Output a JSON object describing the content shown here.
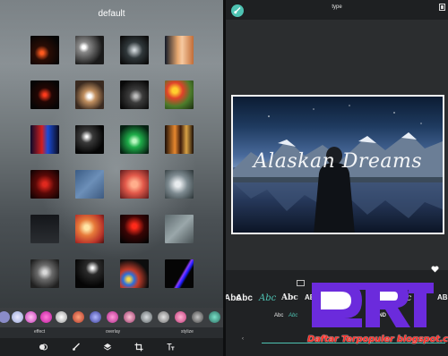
{
  "left_panel": {
    "title": "default",
    "filter_labels": [
      "effect",
      "overlay",
      "stylize"
    ]
  },
  "right_panel": {
    "title": "type",
    "photo_text": "Alaskan Dreams",
    "style_samples": [
      "Abc",
      "Abc",
      "Abc",
      "Abc",
      "AB",
      "AB",
      "Abc",
      "AB"
    ],
    "font_samples": [
      "Abc",
      "Abc",
      "AB"
    ],
    "font_selected": "AND"
  },
  "watermark": {
    "text": "Daftar Terpopuler blogspot.com"
  },
  "icons": {
    "brush": "brush-icon",
    "aspect": "aspect-ratio-icon",
    "like": "heart-icon",
    "toolbar": [
      "effects-icon",
      "brush-icon",
      "layers-icon",
      "crop-icon",
      "text-icon"
    ]
  },
  "colors": {
    "accent": "#4ec3b3",
    "watermark_red": "#ff2a23",
    "logo_purple": "#6b2bdc"
  }
}
